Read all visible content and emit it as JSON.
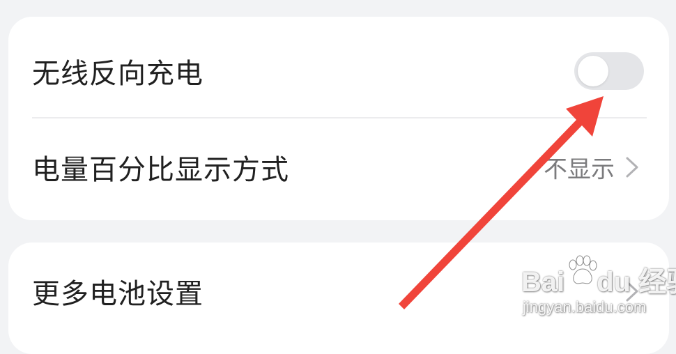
{
  "settings": {
    "wireless_reverse_charging": {
      "label": "无线反向充电",
      "enabled": false
    },
    "battery_percentage_display": {
      "label": "电量百分比显示方式",
      "value": "不显示"
    },
    "more_battery_settings": {
      "label": "更多电池设置"
    }
  },
  "annotation": {
    "color": "#f0443a",
    "icon": "red-arrow-pointing-to-toggle"
  },
  "watermark": {
    "brand_left": "Bai",
    "brand_right": "du",
    "product": "经验",
    "url": "jingyan.baidu.com"
  },
  "colors": {
    "background": "#f2f3f5",
    "card": "#ffffff",
    "toggle_off": "#e4e5e8",
    "secondary_text": "#7b7b7d"
  }
}
